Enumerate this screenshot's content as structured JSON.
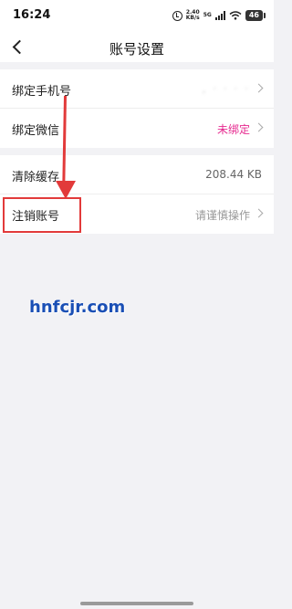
{
  "status_bar": {
    "time": "16:24",
    "speed_value": "2.40",
    "speed_unit": "KB/s",
    "network": "5G",
    "battery": "46"
  },
  "header": {
    "title": "账号设置"
  },
  "settings": {
    "phone": {
      "label": "绑定手机号",
      "value": ",  · · · ·"
    },
    "wechat": {
      "label": "绑定微信",
      "value": "未绑定"
    },
    "cache": {
      "label": "清除缓存",
      "value": "208.44 KB"
    },
    "cancel_account": {
      "label": "注销账号",
      "value": "请谨慎操作"
    }
  },
  "colors": {
    "accent": "#e6298f",
    "annotation": "#e23a3a",
    "watermark": "#1a4fb5"
  },
  "watermark": "hnfcjr.com"
}
